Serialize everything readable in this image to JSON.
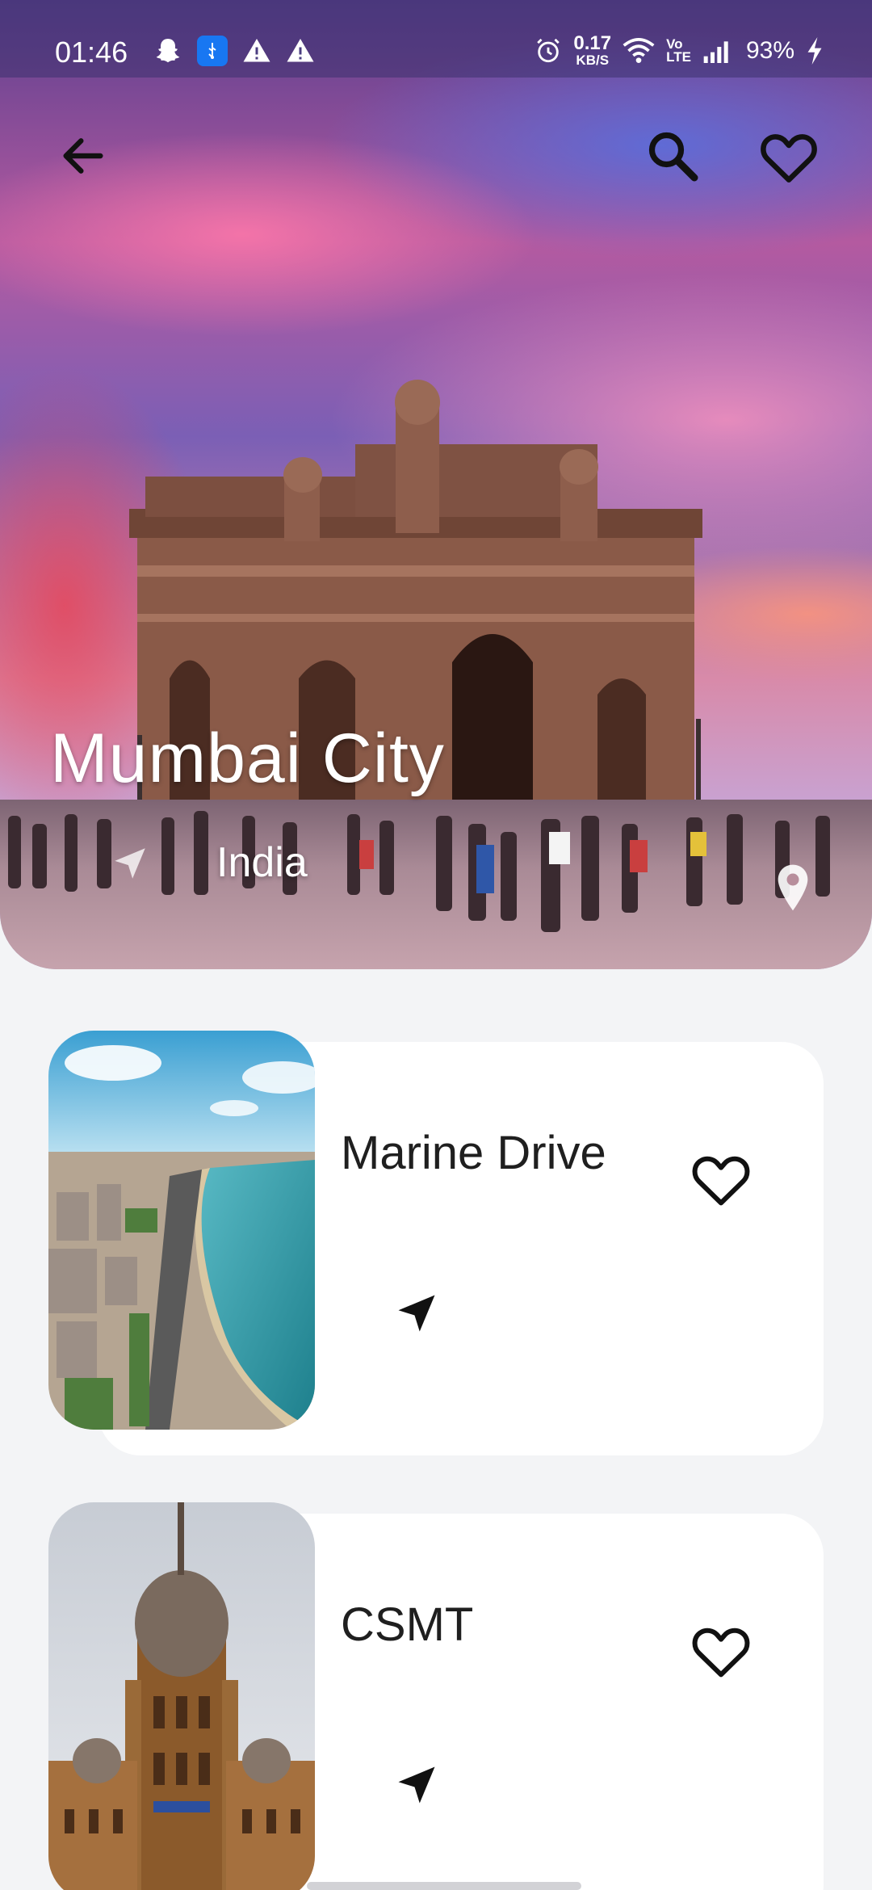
{
  "status_bar": {
    "time": "01:46",
    "net_speed": "0.17",
    "net_unit": "KB/S",
    "volte_top": "Vo",
    "volte_bottom": "LTE",
    "battery": "93%"
  },
  "hero": {
    "title": "Mumbai City",
    "subtitle": "India"
  },
  "places": [
    {
      "name": "Marine Drive"
    },
    {
      "name": "CSMT"
    }
  ],
  "colors": {
    "accent_blue": "#1877f2",
    "card_bg": "#ffffff",
    "page_bg": "#f3f4f6"
  }
}
